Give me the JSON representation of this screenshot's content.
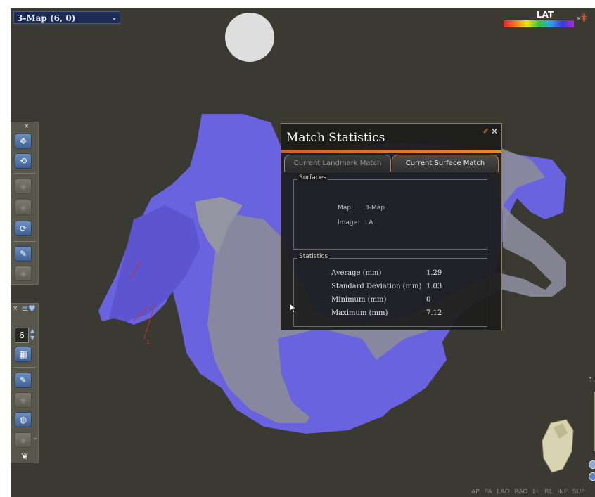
{
  "map_selector": {
    "value": "3-Map (6, 0)"
  },
  "color_scale": {
    "label": "LAT"
  },
  "left_toolbar": {
    "point_count": "6"
  },
  "zoom": {
    "label": "1."
  },
  "view_presets": [
    "AP",
    "PA",
    "LAO",
    "RAO",
    "LL",
    "RL",
    "INF",
    "SUP"
  ],
  "dialog": {
    "title": "Match Statistics",
    "tabs": [
      {
        "label": "Current Landmark Match",
        "active": false
      },
      {
        "label": "Current Surface Match",
        "active": true
      }
    ],
    "surfaces": {
      "title": "Surfaces",
      "map_label": "Map:",
      "map_value": "3-Map",
      "image_label": "Image:",
      "image_value": "LA"
    },
    "statistics": {
      "title": "Statistics",
      "rows": [
        {
          "label": "Average (mm)",
          "value": "1.29"
        },
        {
          "label": "Standard Deviation (mm)",
          "value": "1.03"
        },
        {
          "label": "Minimum (mm)",
          "value": "0"
        },
        {
          "label": "Maximum (mm)",
          "value": "7.12"
        }
      ]
    }
  },
  "colors": {
    "background": "#3b3a32",
    "mesh_blue": "#6a63e0",
    "mesh_gray": "#8a8a9a",
    "dialog_accent": "#d4601e"
  }
}
